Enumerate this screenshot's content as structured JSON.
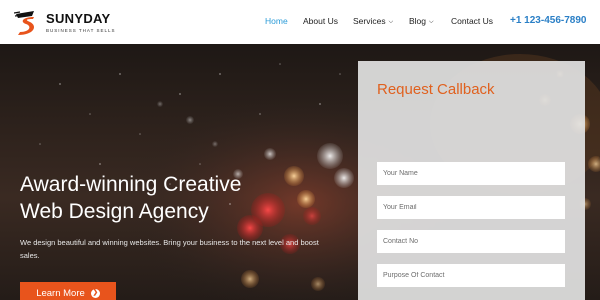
{
  "brand": {
    "name": "SUNYDAY",
    "tagline": "BUSINESS THAT SELLS"
  },
  "nav": {
    "items": [
      {
        "label": "Home",
        "active": true,
        "has_dropdown": false
      },
      {
        "label": "About Us",
        "active": false,
        "has_dropdown": false
      },
      {
        "label": "Services",
        "active": false,
        "has_dropdown": true
      },
      {
        "label": "Blog",
        "active": false,
        "has_dropdown": true
      },
      {
        "label": "Contact Us",
        "active": false,
        "has_dropdown": false
      }
    ],
    "phone": "+1 123-456-7890"
  },
  "hero": {
    "title_line1": "Award-winning Creative",
    "title_line2": "Web Design Agency",
    "subtitle": "We design beautiful and winning websites. Bring your business to the next level and boost sales.",
    "cta_label": "Learn More",
    "cta_icon": "chevron-right-circle-icon"
  },
  "callback_form": {
    "title": "Request Callback",
    "fields": [
      {
        "placeholder": "Your Name",
        "value": ""
      },
      {
        "placeholder": "Your Email",
        "value": ""
      },
      {
        "placeholder": "Contact No",
        "value": ""
      },
      {
        "placeholder": "Purpose Of Contact",
        "value": ""
      }
    ]
  },
  "colors": {
    "accent_orange": "#e8541c",
    "nav_active": "#2a9bd8",
    "phone": "#2a7fc6",
    "form_title": "#e0611f"
  }
}
